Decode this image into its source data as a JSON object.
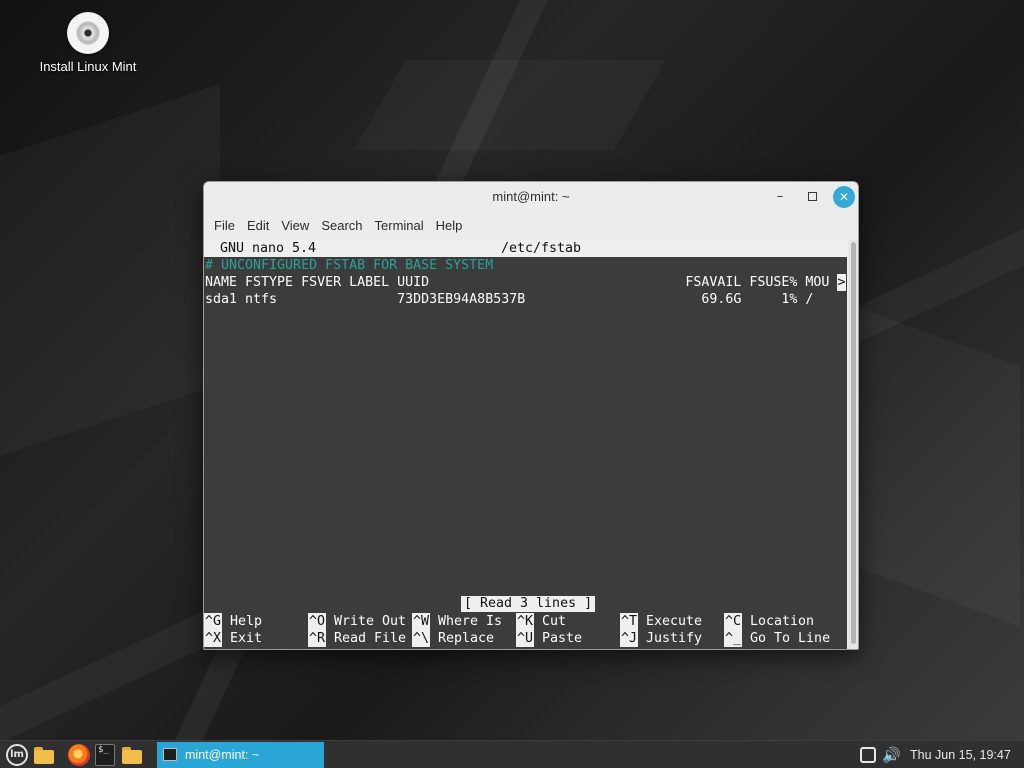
{
  "desktop": {
    "icons": [
      {
        "label": "Install Linux Mint",
        "icon": "disc-icon"
      }
    ]
  },
  "window": {
    "title": "mint@mint: ~",
    "buttons": {
      "minimize": "–",
      "close": "✕"
    },
    "menu": [
      "File",
      "Edit",
      "View",
      "Search",
      "Terminal",
      "Help"
    ]
  },
  "nano": {
    "version": "GNU nano 5.4",
    "filename": "/etc/fstab",
    "lines": [
      "# UNCONFIGURED FSTAB FOR BASE SYSTEM",
      "NAME FSTYPE FSVER LABEL UUID                                FSAVAIL FSUSE% MOU",
      "sda1 ntfs               73DD3EB94A8B537B                      69.6G     1% /"
    ],
    "overflow_marker": ">",
    "status": "[ Read 3 lines ]",
    "shortcuts": [
      {
        "key": "^G",
        "label": "Help"
      },
      {
        "key": "^X",
        "label": "Exit"
      },
      {
        "key": "^O",
        "label": "Write Out"
      },
      {
        "key": "^R",
        "label": "Read File"
      },
      {
        "key": "^W",
        "label": "Where Is"
      },
      {
        "key": "^\\",
        "label": "Replace"
      },
      {
        "key": "^K",
        "label": "Cut"
      },
      {
        "key": "^U",
        "label": "Paste"
      },
      {
        "key": "^T",
        "label": "Execute"
      },
      {
        "key": "^J",
        "label": "Justify"
      },
      {
        "key": "^C",
        "label": "Location"
      },
      {
        "key": "^_",
        "label": "Go To Line"
      }
    ],
    "colors": {
      "background": "#3c3c3c",
      "comment": "#2aa198",
      "highlight": "#efefef"
    }
  },
  "taskbar": {
    "launchers": [
      "mint-menu-icon",
      "folder-icon",
      "firefox-icon",
      "terminal-icon",
      "files-icon"
    ],
    "terminal_glyph": "$_",
    "tasks": [
      {
        "label": "mint@mint: ~",
        "icon": "terminal-icon",
        "active": true
      }
    ],
    "tray": [
      "network-icon",
      "volume-icon"
    ],
    "volume_glyph": "🔊",
    "clock": "Thu Jun 15, 19:47",
    "accent": "#2aa6d6"
  }
}
